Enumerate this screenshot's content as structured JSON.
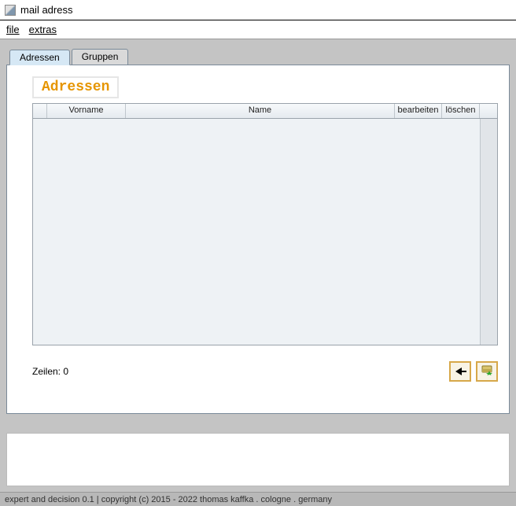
{
  "window": {
    "title": "mail adress"
  },
  "menu": {
    "file": "file",
    "extras": "extras"
  },
  "tabs": {
    "addresses": "Adressen",
    "groups": "Gruppen"
  },
  "panel": {
    "heading": "Adressen"
  },
  "table": {
    "headers": {
      "vorname": "Vorname",
      "name": "Name",
      "edit": "bearbeiten",
      "delete": "löschen"
    },
    "rows": []
  },
  "footer": {
    "row_count_label": "Zeilen: 0"
  },
  "status": {
    "text": "expert and decision 0.1 | copyright (c) 2015 - 2022 thomas kaffka . cologne . germany"
  }
}
